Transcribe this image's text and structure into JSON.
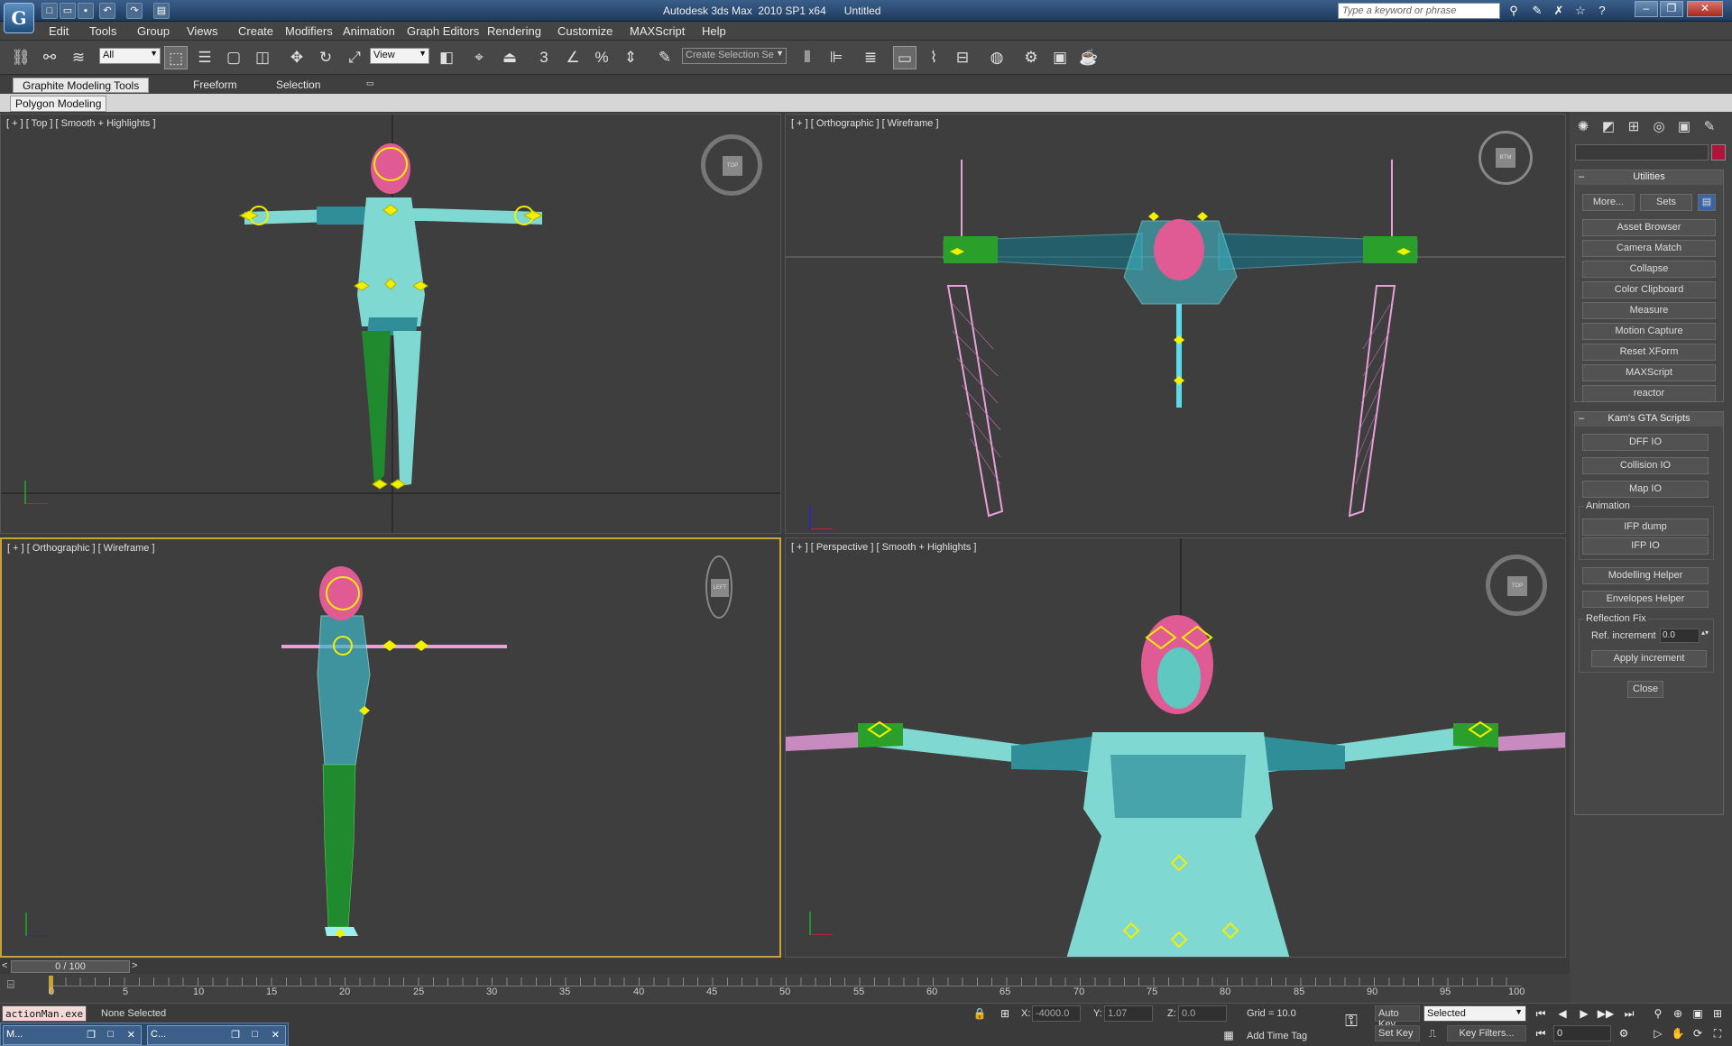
{
  "window": {
    "title": "Autodesk 3ds Max  2010 SP1 x64      Untitled",
    "search_placeholder": "Type a keyword or phrase",
    "logo_glyph": "G"
  },
  "menu": [
    "Edit",
    "Tools",
    "Group",
    "Views",
    "Create",
    "Modifiers",
    "Animation",
    "Graph Editors",
    "Rendering",
    "Customize",
    "MAXScript",
    "Help"
  ],
  "toolbar": {
    "selection_filter": "All",
    "ref_coord": "View",
    "named_selection": "Create Selection Se"
  },
  "ribbon": {
    "tabs": [
      "Graphite Modeling Tools",
      "Freeform",
      "Selection"
    ],
    "panel_label": "Polygon Modeling"
  },
  "viewports": {
    "top_left": {
      "label": "[ + ] [ Top ] [ Smooth + Highlights ]",
      "cube": "TOP"
    },
    "top_right": {
      "label": "[ + ] [ Orthographic ] [ Wireframe ]",
      "cube": "BTM"
    },
    "bottom_left": {
      "label": "[ + ] [ Orthographic ] [ Wireframe ]",
      "cube": "LEFT"
    },
    "bottom_right": {
      "label": "[ + ] [ Perspective ] [ Smooth + Highlights ]",
      "cube": "TOP"
    }
  },
  "command_panel": {
    "utilities": {
      "title": "Utilities",
      "more": "More...",
      "sets": "Sets",
      "buttons": [
        "Asset Browser",
        "Camera Match",
        "Collapse",
        "Color Clipboard",
        "Measure",
        "Motion Capture",
        "Reset XForm",
        "MAXScript",
        "reactor"
      ]
    },
    "kams": {
      "title": "Kam's GTA Scripts",
      "buttons": [
        "DFF IO",
        "Collision IO",
        "Map IO"
      ],
      "animation_label": "Animation",
      "anim_buttons": [
        "IFP dump",
        "IFP IO"
      ],
      "helper_buttons": [
        "Modelling Helper",
        "Envelopes Helper"
      ],
      "reflection_label": "Reflection Fix",
      "ref_increment_label": "Ref. increment",
      "ref_increment_value": "0.0",
      "apply": "Apply increment",
      "close": "Close"
    }
  },
  "timeline": {
    "slider_text": "0 / 100",
    "ticks": [
      "0",
      "5",
      "10",
      "15",
      "20",
      "25",
      "30",
      "35",
      "40",
      "45",
      "50",
      "55",
      "60",
      "65",
      "70",
      "75",
      "80",
      "85",
      "90",
      "95",
      "100"
    ]
  },
  "status": {
    "maxscript_listener": "actionMan.exe",
    "selection": "None Selected",
    "x_label": "X:",
    "x_value": "-4000.0",
    "y_label": "Y:",
    "y_value": "1.07",
    "z_label": "Z:",
    "z_value": "0.0",
    "grid": "Grid = 10.0",
    "add_time_tag": "Add Time Tag",
    "auto_key": "Auto Key",
    "set_key": "Set Key",
    "key_mode": "Selected",
    "key_filters": "Key Filters...",
    "frame": "0"
  },
  "taskbar": {
    "item1": "M...",
    "item2": "C..."
  }
}
